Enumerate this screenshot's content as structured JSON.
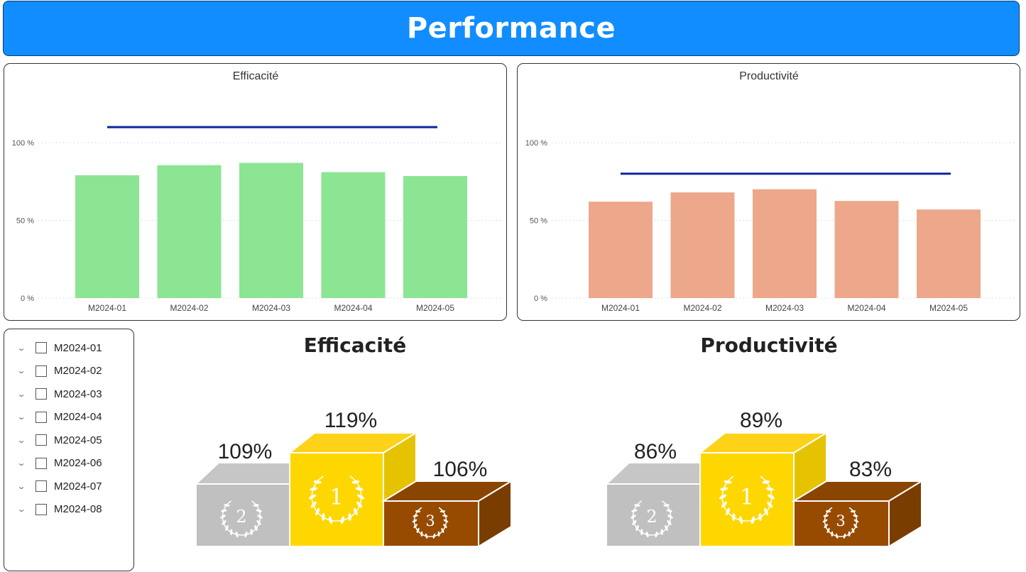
{
  "header": {
    "title": "Performance"
  },
  "colors": {
    "header_bg": "#118DFF",
    "efficacite_bar": "#8BE592",
    "productivite_bar": "#EDA78A",
    "target_line": "#12239E",
    "gold": "#FFD700",
    "silver": "#C0C0C0",
    "bronze": "#964B00"
  },
  "chart_data": [
    {
      "type": "bar",
      "title": "Efficacité",
      "categories": [
        "M2024-01",
        "M2024-02",
        "M2024-03",
        "M2024-04",
        "M2024-05"
      ],
      "values": [
        0.79,
        0.855,
        0.87,
        0.81,
        0.785
      ],
      "target": 1.1,
      "yticks": [
        "100 %",
        "50 %",
        "0 %"
      ],
      "ylim": [
        0,
        1.2
      ],
      "grid": true
    },
    {
      "type": "bar",
      "title": "Productivité",
      "categories": [
        "M2024-01",
        "M2024-02",
        "M2024-03",
        "M2024-04",
        "M2024-05"
      ],
      "values": [
        0.62,
        0.68,
        0.7,
        0.625,
        0.57
      ],
      "target": 0.8,
      "yticks": [
        "100 %",
        "50 %",
        "0 %"
      ],
      "ylim": [
        0,
        1.2
      ],
      "grid": true
    }
  ],
  "slicer": {
    "items": [
      "M2024-01",
      "M2024-02",
      "M2024-03",
      "M2024-04",
      "M2024-05",
      "M2024-06",
      "M2024-07",
      "M2024-08"
    ]
  },
  "podiums": [
    {
      "title": "Efficacité",
      "first": "119%",
      "second": "109%",
      "third": "106%"
    },
    {
      "title": "Productivité",
      "first": "89%",
      "second": "86%",
      "third": "83%"
    }
  ],
  "ranks": {
    "first": "1",
    "second": "2",
    "third": "3"
  }
}
